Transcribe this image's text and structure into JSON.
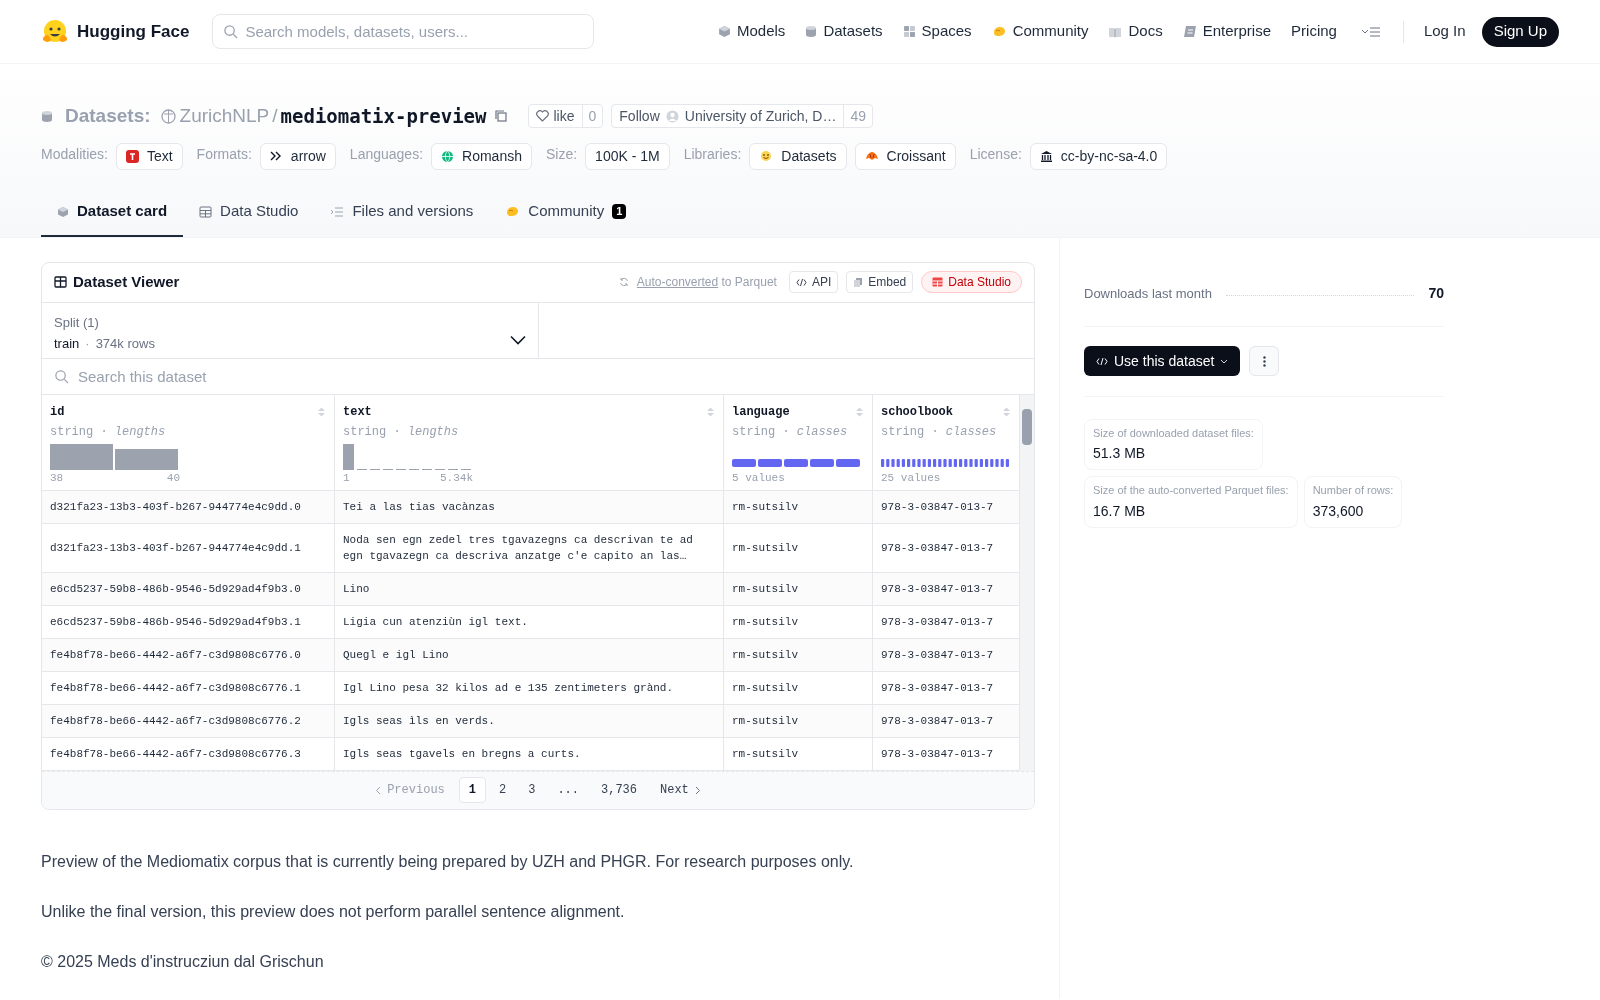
{
  "nav": {
    "brand": "Hugging Face",
    "search": {
      "placeholder": "Search models, datasets, users..."
    },
    "links": [
      {
        "label": "Models",
        "kind": "models"
      },
      {
        "label": "Datasets",
        "kind": "datasets"
      },
      {
        "label": "Spaces",
        "kind": "spaces"
      },
      {
        "label": "Community",
        "kind": "community"
      },
      {
        "label": "Docs",
        "kind": "docs"
      },
      {
        "label": "Enterprise",
        "kind": "enterprise"
      },
      {
        "label": "Pricing",
        "kind": "plain"
      }
    ],
    "login": "Log In",
    "signup": "Sign Up"
  },
  "header": {
    "section": "Datasets:",
    "org": "ZurichNLP",
    "separator": "/",
    "name": "mediomatix-preview",
    "like": {
      "label": "like",
      "count": "0"
    },
    "follow": {
      "label": "Follow",
      "org": "University of Zurich, D…",
      "count": "49"
    }
  },
  "tags": [
    {
      "label": "Modalities:",
      "items": [
        {
          "text": "Text",
          "kind": "text"
        }
      ]
    },
    {
      "label": "Formats:",
      "items": [
        {
          "text": "arrow",
          "kind": "arrow"
        }
      ]
    },
    {
      "label": "Languages:",
      "items": [
        {
          "text": "Romansh",
          "kind": "globe"
        }
      ]
    },
    {
      "label": "Size:",
      "items": [
        {
          "text": "100K - 1M",
          "kind": "plain"
        }
      ]
    },
    {
      "label": "Libraries:",
      "items": [
        {
          "text": "Datasets",
          "kind": "hf"
        },
        {
          "text": "Croissant",
          "kind": "croissant"
        }
      ]
    },
    {
      "label": "License:",
      "items": [
        {
          "text": "cc-by-nc-sa-4.0",
          "kind": "bank"
        }
      ]
    }
  ],
  "tabs": [
    {
      "label": "Dataset card",
      "kind": "card",
      "selected": true
    },
    {
      "label": "Data Studio",
      "kind": "table",
      "selected": false
    },
    {
      "label": "Files and versions",
      "kind": "files",
      "selected": false
    },
    {
      "label": "Community",
      "kind": "community",
      "selected": false,
      "badge": "1"
    }
  ],
  "viewer": {
    "title": "Dataset Viewer",
    "converted_link": "Auto-converted",
    "converted_text": "to Parquet",
    "buttons": [
      {
        "label": "API",
        "kind": "api"
      },
      {
        "label": "Embed",
        "kind": "embed"
      },
      {
        "label": "Data Studio",
        "kind": "studio"
      }
    ],
    "split": {
      "label": "Split (1)",
      "value": "train",
      "separator": "·",
      "rows": "374k rows"
    },
    "search": {
      "placeholder": "Search this dataset"
    },
    "columns": [
      {
        "name": "id",
        "type": "string",
        "separator": "·",
        "stat": "lengths",
        "kind": "lengths",
        "low": "38",
        "high": "40"
      },
      {
        "name": "text",
        "type": "string",
        "separator": "·",
        "stat": "lengths",
        "kind": "lengths",
        "low": "1",
        "high": "5.34k"
      },
      {
        "name": "language",
        "type": "string",
        "separator": "·",
        "stat": "classes",
        "kind": "classes",
        "count": "5 values"
      },
      {
        "name": "schoolbook",
        "type": "string",
        "separator": "·",
        "stat": "classes",
        "kind": "classes",
        "count": "25 values"
      }
    ],
    "rows": [
      [
        "d321fa23-13b3-403f-b267-944774e4c9dd.0",
        "Tei a las tias vacànzas",
        "rm-sutsilv",
        "978-3-03847-013-7"
      ],
      [
        "d321fa23-13b3-403f-b267-944774e4c9dd.1",
        "Noda sen egn zedel tres tgavazegns ca descrivan te ad egn tgavazegn ca descriva anzatge c'e capito an las…",
        "rm-sutsilv",
        "978-3-03847-013-7"
      ],
      [
        "e6cd5237-59b8-486b-9546-5d929ad4f9b3.0",
        "Lino",
        "rm-sutsilv",
        "978-3-03847-013-7"
      ],
      [
        "e6cd5237-59b8-486b-9546-5d929ad4f9b3.1",
        "Ligia cun atenziùn igl text.",
        "rm-sutsilv",
        "978-3-03847-013-7"
      ],
      [
        "fe4b8f78-be66-4442-a6f7-c3d9808c6776.0",
        "Quegl e igl Lino",
        "rm-sutsilv",
        "978-3-03847-013-7"
      ],
      [
        "fe4b8f78-be66-4442-a6f7-c3d9808c6776.1",
        "Igl Lino pesa 32 kilos ad e 135 zentimeters grànd.",
        "rm-sutsilv",
        "978-3-03847-013-7"
      ],
      [
        "fe4b8f78-be66-4442-a6f7-c3d9808c6776.2",
        "Igls seas ìls en verds.",
        "rm-sutsilv",
        "978-3-03847-013-7"
      ],
      [
        "fe4b8f78-be66-4442-a6f7-c3d9808c6776.3",
        "Igls seas tgavels en bregns a curts.",
        "rm-sutsilv",
        "978-3-03847-013-7"
      ]
    ],
    "pagination": {
      "previous": "Previous",
      "next": "Next",
      "pages": [
        {
          "label": "1",
          "selected": true
        },
        {
          "label": "2",
          "selected": false
        },
        {
          "label": "3",
          "selected": false
        },
        {
          "label": "...",
          "selected": false
        },
        {
          "label": "3,736",
          "selected": false
        }
      ]
    }
  },
  "description": [
    "Preview of the Mediomatix corpus that is currently being prepared by UZH and PHGR. For research purposes only.",
    "Unlike the final version, this preview does not perform parallel sentence alignment.",
    "© 2025 Meds d'instrucziun dal Grischun"
  ],
  "sidebar": {
    "downloads_label": "Downloads last month",
    "downloads": "70",
    "use_button": "Use this dataset",
    "stats": [
      {
        "label": "Size of downloaded dataset files:",
        "value": "51.3 MB"
      },
      {
        "label": "Size of the auto-converted Parquet files:",
        "value": "16.7 MB"
      },
      {
        "label": "Number of rows:",
        "value": "373,600"
      }
    ]
  }
}
